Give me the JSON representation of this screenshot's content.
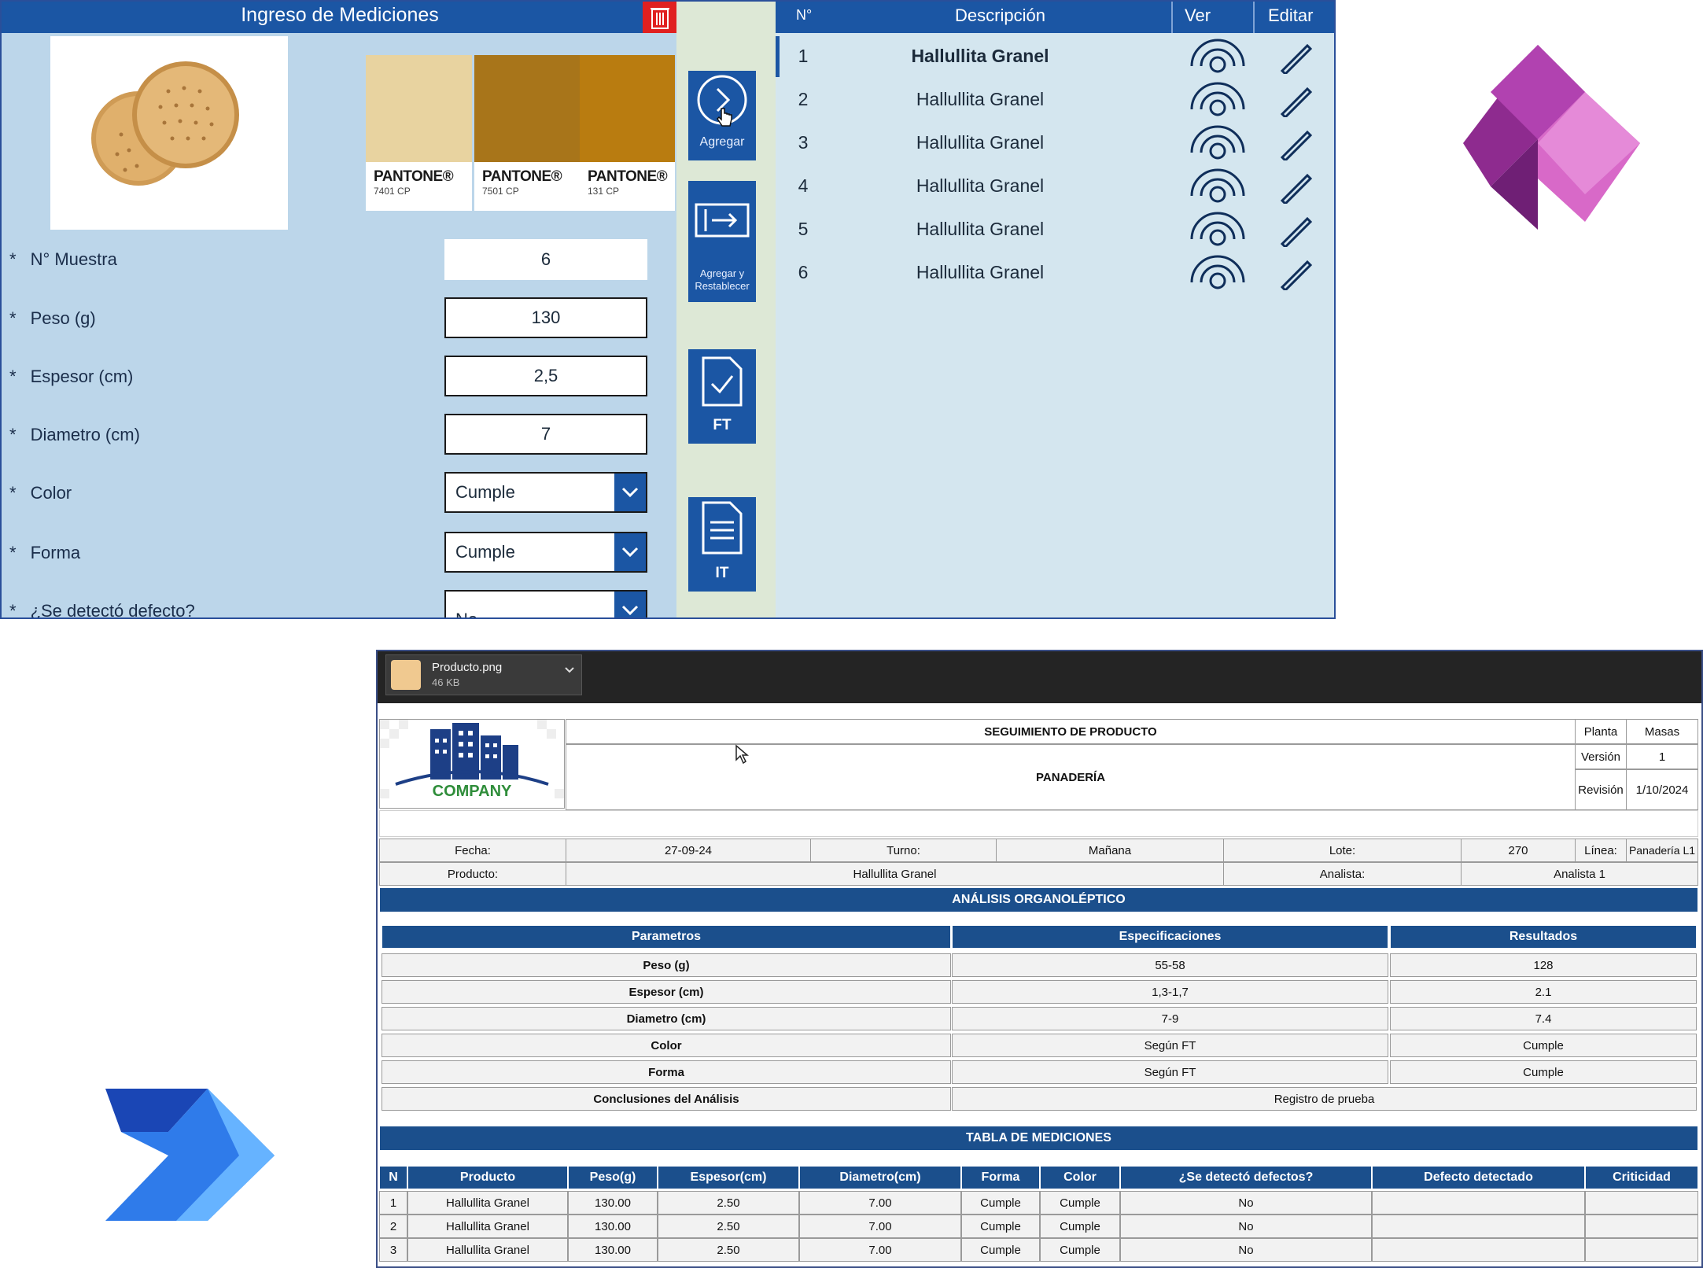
{
  "app": {
    "header_title": "Ingreso de Mediciones",
    "swatches": [
      {
        "brand": "PANTONE®",
        "code": "7401 CP",
        "color": "#e8d3a0"
      },
      {
        "brand": "PANTONE®",
        "code": "7501 CP",
        "color": "#a8751a"
      },
      {
        "brand": "PANTONE®",
        "code": "131 CP",
        "color": "#b97c10"
      }
    ],
    "fields": [
      {
        "label": "N° Muestra",
        "value": "6"
      },
      {
        "label": "Peso (g)",
        "value": "130"
      },
      {
        "label": "Espesor (cm)",
        "value": "2,5"
      },
      {
        "label": "Diametro (cm)",
        "value": "7"
      },
      {
        "label": "Color",
        "value": "Cumple"
      },
      {
        "label": "Forma",
        "value": "Cumple"
      },
      {
        "label": "¿Se detectó defecto?",
        "value": "No"
      }
    ],
    "required_mark": "*",
    "buttons": {
      "agregar": "Agregar",
      "agregar_restablecer_1": "Agregar y",
      "agregar_restablecer_2": "Restablecer",
      "ft": "FT",
      "it": "IT"
    },
    "list": {
      "headers": {
        "num": "N°",
        "desc": "Descripción",
        "ver": "Ver",
        "editar": "Editar"
      },
      "rows": [
        {
          "num": "1",
          "desc": "Hallullita Granel"
        },
        {
          "num": "2",
          "desc": "Hallullita Granel"
        },
        {
          "num": "3",
          "desc": "Hallullita Granel"
        },
        {
          "num": "4",
          "desc": "Hallullita Granel"
        },
        {
          "num": "5",
          "desc": "Hallullita Granel"
        },
        {
          "num": "6",
          "desc": "Hallullita Granel"
        }
      ]
    }
  },
  "attachment": {
    "name": "Producto.png",
    "size": "46 KB"
  },
  "report": {
    "logo_text": "COMPANY",
    "title": "SEGUIMIENTO DE PRODUCTO",
    "subtitle": "PANADERÍA",
    "meta": [
      {
        "label": "Planta",
        "value": "Masas"
      },
      {
        "label": "Versión",
        "value": "1"
      },
      {
        "label": "Revisión",
        "value": "1/10/2024"
      }
    ],
    "info": {
      "fecha_label": "Fecha:",
      "fecha": "27-09-24",
      "turno_label": "Turno:",
      "turno": "Mañana",
      "lote_label": "Lote:",
      "lote": "270",
      "linea_label": "Línea:",
      "linea": "Panadería L1",
      "producto_label": "Producto:",
      "producto": "Hallullita Granel",
      "analista_label": "Analista:",
      "analista": "Analista 1"
    },
    "organoleptic_title": "ANÁLISIS ORGANOLÉPTICO",
    "organoleptic_headers": [
      "Parametros",
      "Especificaciones",
      "Resultados"
    ],
    "organoleptic_rows": [
      {
        "param": "Peso (g)",
        "spec": "55-58",
        "result": "128"
      },
      {
        "param": "Espesor (cm)",
        "spec": "1,3-1,7",
        "result": "2.1"
      },
      {
        "param": "Diametro (cm)",
        "spec": "7-9",
        "result": "7.4"
      },
      {
        "param": "Color",
        "spec": "Según FT",
        "result": "Cumple"
      },
      {
        "param": "Forma",
        "spec": "Según FT",
        "result": "Cumple"
      }
    ],
    "conclusions_label": "Conclusiones del Análisis",
    "conclusions_value": "Registro de prueba",
    "measurements_title": "TABLA DE MEDICIONES",
    "measurement_headers": [
      "N",
      "Producto",
      "Peso(g)",
      "Espesor(cm)",
      "Diametro(cm)",
      "Forma",
      "Color",
      "¿Se detectó defectos?",
      "Defecto detectado",
      "Criticidad"
    ],
    "measurement_rows": [
      [
        "1",
        "Hallullita Granel",
        "130.00",
        "2.50",
        "7.00",
        "Cumple",
        "Cumple",
        "No",
        "",
        ""
      ],
      [
        "2",
        "Hallullita Granel",
        "130.00",
        "2.50",
        "7.00",
        "Cumple",
        "Cumple",
        "No",
        "",
        ""
      ],
      [
        "3",
        "Hallullita Granel",
        "130.00",
        "2.50",
        "7.00",
        "Cumple",
        "Cumple",
        "No",
        "",
        ""
      ]
    ]
  },
  "colors": {
    "app_header": "#1b56a4",
    "report_header": "#1b4f8c",
    "form_bg": "#bcd6ea",
    "delete": "#e02020"
  }
}
